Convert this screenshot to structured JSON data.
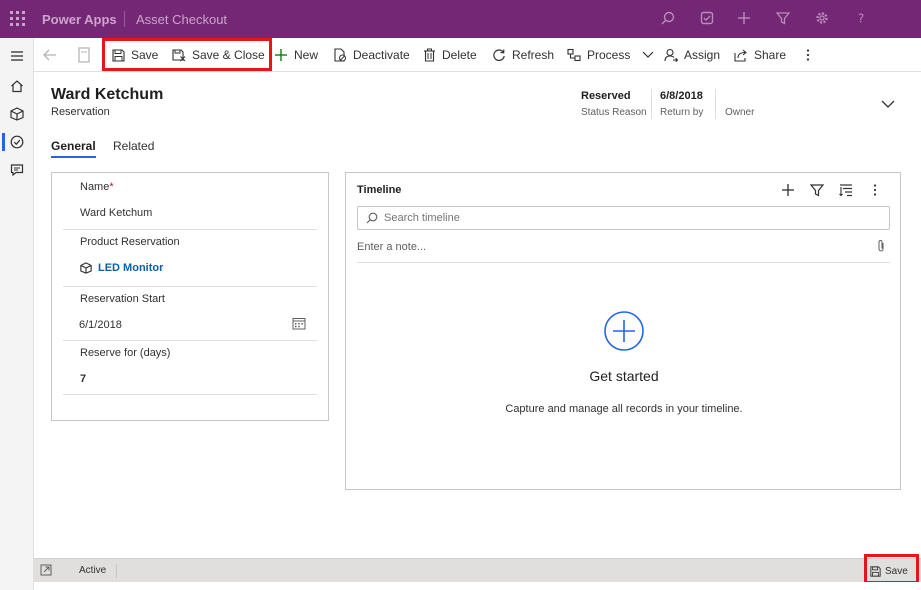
{
  "topbar": {
    "app_name": "Power Apps",
    "entity_name": "Asset Checkout"
  },
  "command_bar": {
    "save_label": "Save",
    "save_close_label": "Save & Close",
    "new_label": "New",
    "deactivate_label": "Deactivate",
    "delete_label": "Delete",
    "refresh_label": "Refresh",
    "process_label": "Process",
    "assign_label": "Assign",
    "share_label": "Share"
  },
  "record": {
    "title": "Ward Ketchum",
    "entity": "Reservation",
    "header_fields": [
      {
        "value": "Reserved",
        "label": "Status Reason"
      },
      {
        "value": "6/8/2018",
        "label": "Return by"
      },
      {
        "value": "",
        "label": "Owner"
      }
    ]
  },
  "tabs": [
    {
      "label": "General",
      "active": true
    },
    {
      "label": "Related",
      "active": false
    }
  ],
  "form": {
    "name": {
      "label": "Name",
      "required_marker": "*",
      "value": "Ward Ketchum"
    },
    "product": {
      "label": "Product Reservation",
      "value": "LED Monitor"
    },
    "start": {
      "label": "Reservation Start",
      "value": "6/1/2018"
    },
    "days": {
      "label": "Reserve for (days)",
      "value": "7"
    }
  },
  "timeline": {
    "title": "Timeline",
    "search_placeholder": "Search timeline",
    "note_placeholder": "Enter a note...",
    "empty_title": "Get started",
    "empty_subtitle": "Capture and manage all records in your timeline."
  },
  "footer": {
    "status": "Active",
    "save_label": "Save"
  },
  "colors": {
    "brand": "#742774",
    "accent": "#2266e3",
    "lookup_link": "#115ea3",
    "highlight": "#e8131b"
  }
}
